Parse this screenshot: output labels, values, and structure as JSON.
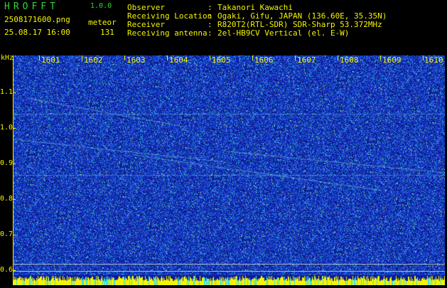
{
  "app": {
    "name": "HROFFT",
    "version": "1.0.0"
  },
  "file": {
    "name": "2508171600.png",
    "datetime": "25.08.17 16:00"
  },
  "meteor": {
    "label": "meteor",
    "count": "131"
  },
  "info": [
    {
      "label": "Observer",
      "value": "Takanori Kawachi"
    },
    {
      "label": "Receiving Location",
      "value": "Ogaki, Gifu, JAPAN (136.60E, 35.35N)"
    },
    {
      "label": "Receiver",
      "value": "R820T2(RTL-SDR) SDR-Sharp 53.372MHz"
    },
    {
      "label": "Receiving antenna",
      "value": "2el-HB9CV Vertical (el. E-W)"
    }
  ],
  "axis": {
    "y_unit": "kHz",
    "y_ticks": [
      "1.1",
      "1.0",
      "0.9",
      "0.8",
      "0.7",
      "0.6"
    ],
    "x_ticks": [
      "1601",
      "1602",
      "1603",
      "1604",
      "1605",
      "1606",
      "1607",
      "1608",
      "1609",
      "1610"
    ]
  },
  "colors": {
    "background": "#000000",
    "label_yellow": "#f4f400",
    "title_green": "#34d434",
    "spectrum_blue": "#1e3cd0"
  }
}
